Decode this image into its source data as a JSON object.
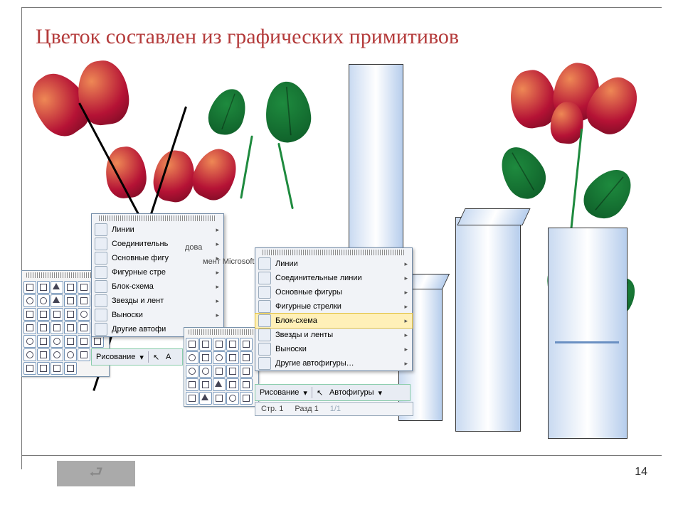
{
  "title": "Цветок составлен из  графических примитивов",
  "page_number": "14",
  "back_arrow": "⮐",
  "word_hint": "дова",
  "word_hint2": "мент Microsoft",
  "menu1": {
    "items": [
      {
        "label": "Линии"
      },
      {
        "label": "Соединительнь"
      },
      {
        "label": "Основные фигу"
      },
      {
        "label": "Фигурные стре"
      },
      {
        "label": "Блок-схема"
      },
      {
        "label": "Звезды и лент"
      },
      {
        "label": "Выноски"
      },
      {
        "label": "Другие автофи"
      }
    ]
  },
  "menu2": {
    "items": [
      {
        "label": "Линии"
      },
      {
        "label": "Соединительные линии"
      },
      {
        "label": "Основные фигуры"
      },
      {
        "label": "Фигурные стрелки"
      },
      {
        "label": "Блок-схема",
        "selected": true
      },
      {
        "label": "Звезды и ленты"
      },
      {
        "label": "Выноски"
      },
      {
        "label": "Другие автофигуры…"
      }
    ]
  },
  "toolbar1": {
    "draw": "Рисование",
    "auto": "А"
  },
  "toolbar2": {
    "draw": "Рисование",
    "auto": "Автофигуры"
  },
  "status": {
    "page": "Стр.  1",
    "section": "Разд 1",
    "pages": "1/1"
  }
}
